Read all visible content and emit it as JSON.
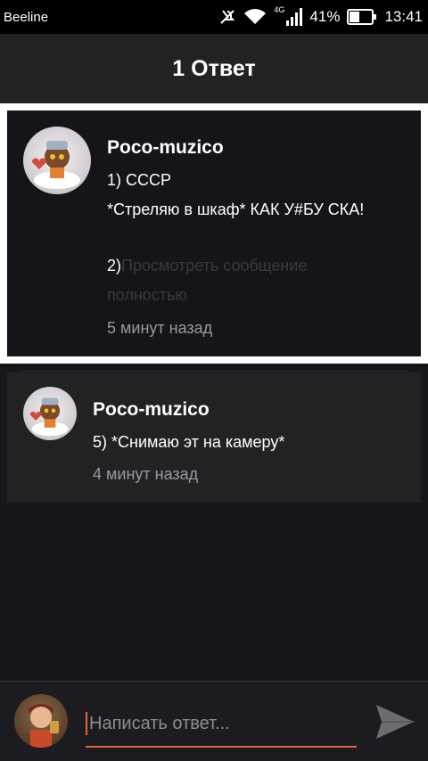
{
  "status_bar": {
    "carrier": "Beeline",
    "network": "4G",
    "battery": "41%",
    "time": "13:41",
    "icons": [
      "mute-icon",
      "wifi-icon",
      "signal-icon",
      "battery-icon"
    ]
  },
  "header": {
    "title": "1 Ответ"
  },
  "comments": [
    {
      "author": "Poco-muzico",
      "lines": [
        "1) СССР",
        "*Стреляю в шкаф* КАК У#БУ СКА!",
        "2)"
      ],
      "more_label": "Просмотреть сообщение",
      "more_label_cont": "полностью",
      "time": "5 минут назад",
      "highlighted": true
    },
    {
      "author": "Poco-muzico",
      "lines": [
        "5) *Снимаю эт на камеру*"
      ],
      "time": "4 минут назад",
      "highlighted": false
    }
  ],
  "reply": {
    "placeholder": "Написать ответ...",
    "value": "",
    "accent": "#e2643f"
  },
  "colors": {
    "background": "#17161a",
    "header": "#222124",
    "card": "#222124",
    "accent": "#e2643f"
  }
}
